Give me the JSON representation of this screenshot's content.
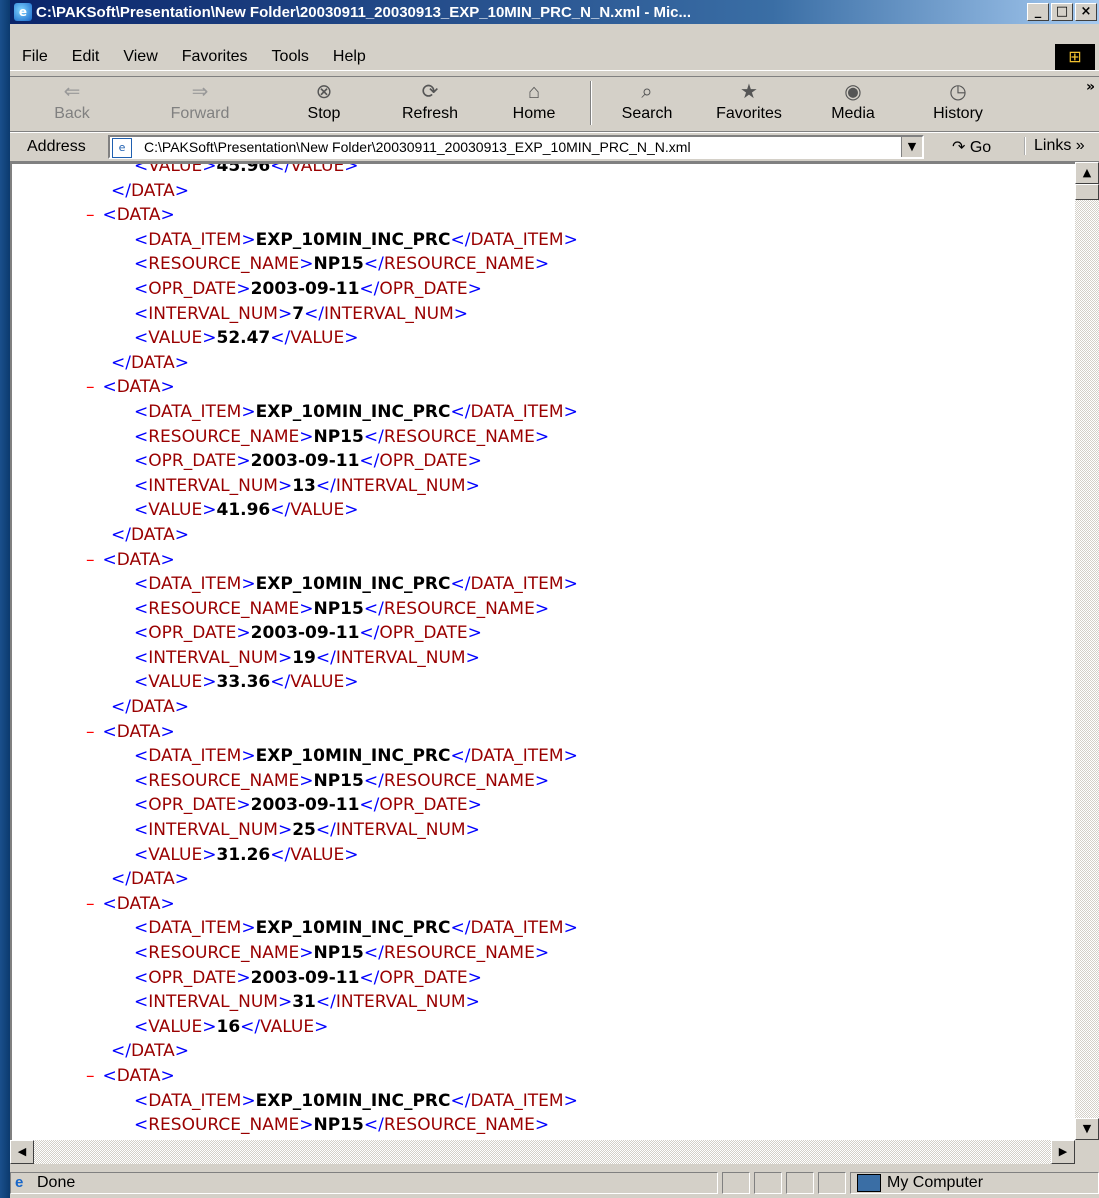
{
  "window": {
    "title": "C:\\PAKSoft\\Presentation\\New Folder\\20030911_20030913_EXP_10MIN_PRC_N_N.xml - Mic...",
    "controls": {
      "minimize": "_",
      "maximize": "□",
      "close": "×"
    }
  },
  "menu": {
    "items": [
      "File",
      "Edit",
      "View",
      "Favorites",
      "Tools",
      "Help"
    ]
  },
  "toolbar": {
    "back": "Back",
    "forward": "Forward",
    "stop": "Stop",
    "refresh": "Refresh",
    "home": "Home",
    "search": "Search",
    "favorites": "Favorites",
    "media": "Media",
    "history": "History",
    "overflow": "»"
  },
  "address": {
    "label": "Address",
    "url": "C:\\PAKSoft\\Presentation\\New Folder\\20030911_20030913_EXP_10MIN_PRC_N_N.xml",
    "go": "Go",
    "links": "Links »"
  },
  "xml": {
    "records": [
      {
        "data_item": "EXP_10MIN_INC_PRC",
        "resource_name": "NP15",
        "opr_date": "2003-09-11",
        "interval_num": "7",
        "value": "52.47"
      },
      {
        "data_item": "EXP_10MIN_INC_PRC",
        "resource_name": "NP15",
        "opr_date": "2003-09-11",
        "interval_num": "13",
        "value": "41.96"
      },
      {
        "data_item": "EXP_10MIN_INC_PRC",
        "resource_name": "NP15",
        "opr_date": "2003-09-11",
        "interval_num": "19",
        "value": "33.36"
      },
      {
        "data_item": "EXP_10MIN_INC_PRC",
        "resource_name": "NP15",
        "opr_date": "2003-09-11",
        "interval_num": "25",
        "value": "31.26"
      },
      {
        "data_item": "EXP_10MIN_INC_PRC",
        "resource_name": "NP15",
        "opr_date": "2003-09-11",
        "interval_num": "31",
        "value": "16"
      },
      {
        "data_item": "EXP_10MIN_INC_PRC",
        "resource_name": "NP15"
      }
    ],
    "top_partial_value": "45.96"
  },
  "status": {
    "text": "Done",
    "zone": "My Computer"
  }
}
